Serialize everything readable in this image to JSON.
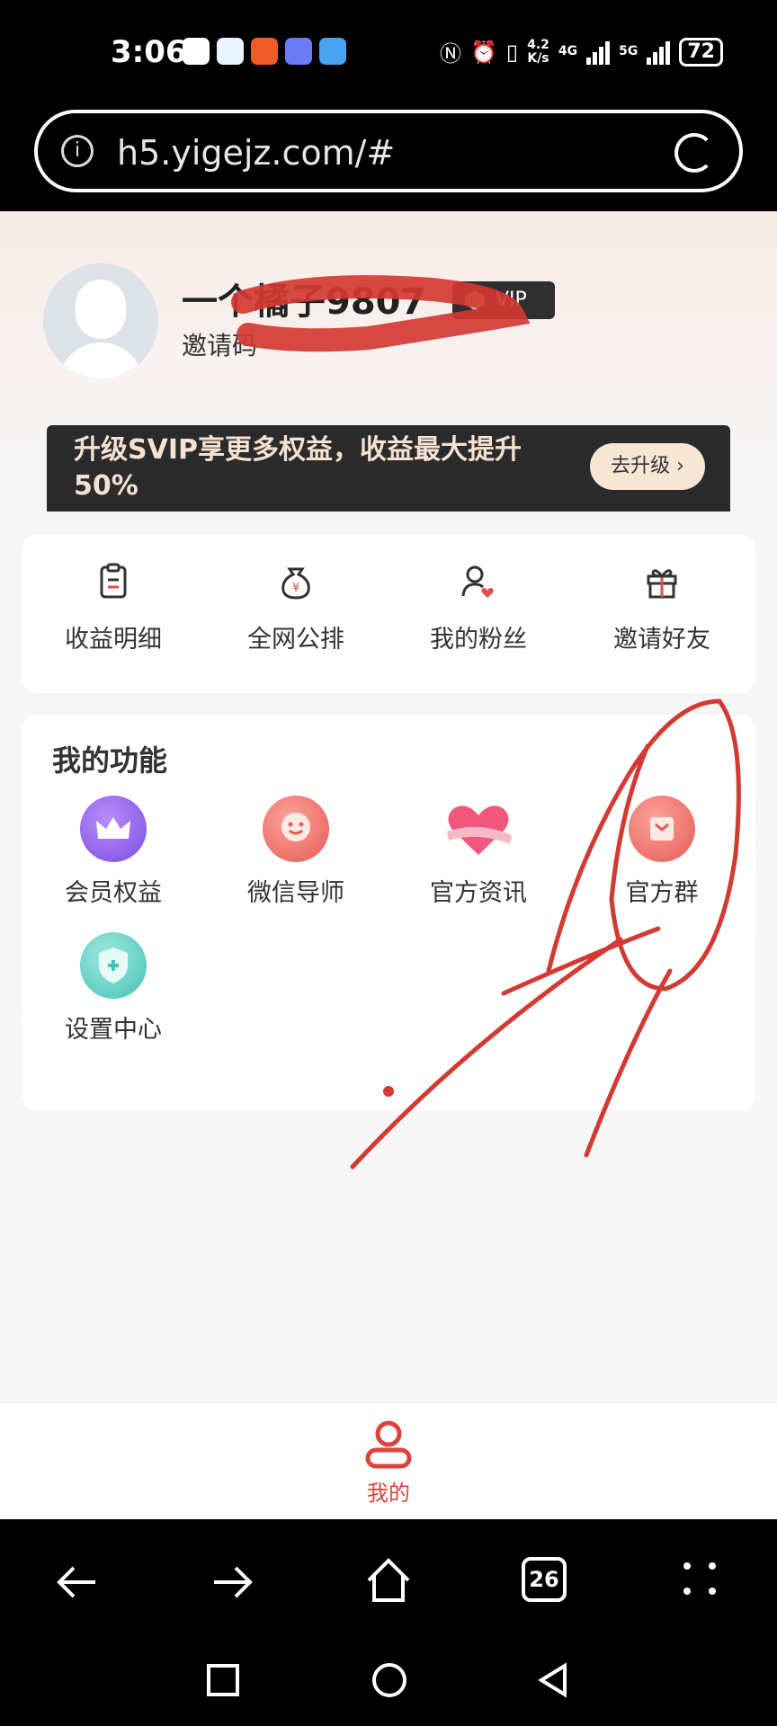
{
  "status_bar": {
    "time": "3:06",
    "net_speed_top": "4.2",
    "net_speed_bottom": "K/s",
    "net_1": "4G",
    "net_2": "5G",
    "battery": "72"
  },
  "browser": {
    "url": "h5.yigejz.com/#",
    "info_glyph": "i",
    "tabs_count": "26"
  },
  "profile": {
    "username": "一个橘子9807",
    "vip_label": "VIP",
    "invite_text": "邀请码"
  },
  "banner": {
    "text": "升级SVIP享更多权益，收益最大提升50%",
    "button": "去升级 ›"
  },
  "quick_actions": [
    {
      "label": "收益明细",
      "icon": "clipboard-icon"
    },
    {
      "label": "全网公排",
      "icon": "money-bag-icon"
    },
    {
      "label": "我的粉丝",
      "icon": "user-heart-icon"
    },
    {
      "label": "邀请好友",
      "icon": "gift-icon"
    }
  ],
  "functions": {
    "title": "我的功能",
    "items": [
      {
        "label": "会员权益",
        "icon": "crown-icon"
      },
      {
        "label": "微信导师",
        "icon": "smile-icon"
      },
      {
        "label": "官方资讯",
        "icon": "heart-icon"
      },
      {
        "label": "官方群",
        "icon": "group-icon"
      },
      {
        "label": "设置中心",
        "icon": "shield-icon"
      }
    ]
  },
  "tab_bar": {
    "active_label": "我的",
    "icon": "person-icon"
  },
  "colors": {
    "accent": "#d9443c",
    "banner_bg": "#2b2b2b",
    "annotation": "#d23a32"
  }
}
